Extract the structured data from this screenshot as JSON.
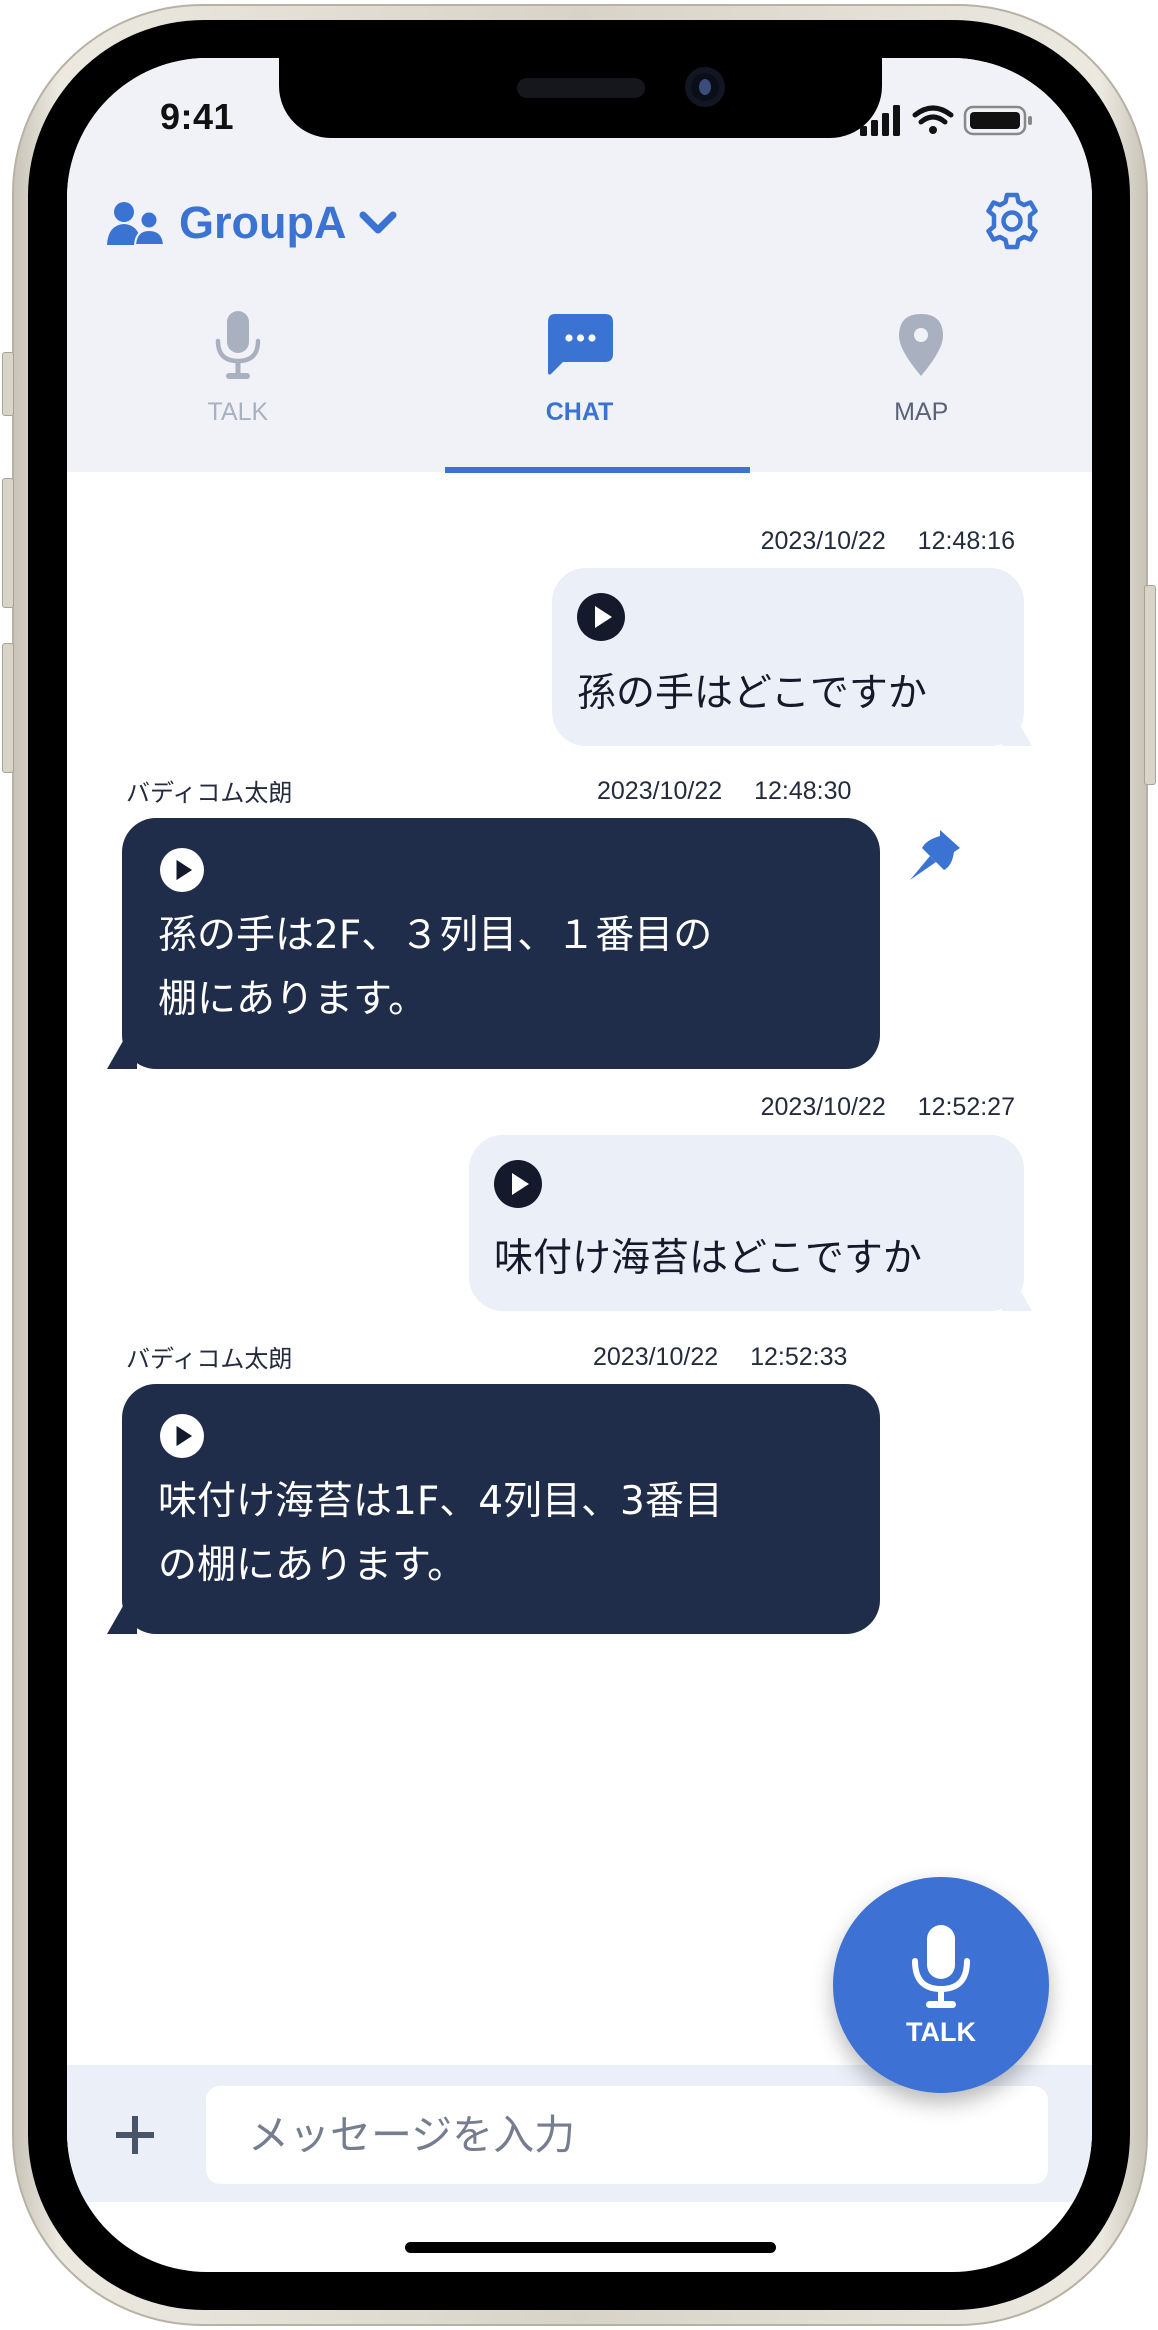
{
  "status_bar": {
    "time": "9:41",
    "icons": [
      "signal-icon",
      "wifi-icon",
      "battery-icon"
    ]
  },
  "header": {
    "group_icon": "group-users-icon",
    "group_name": "GroupA",
    "dropdown_icon": "chevron-down-icon",
    "settings_icon": "gear-icon"
  },
  "tabs": [
    {
      "label": "TALK",
      "icon": "microphone-icon",
      "active": false
    },
    {
      "label": "CHAT",
      "icon": "chat-bubble-icon",
      "active": true
    },
    {
      "label": "MAP",
      "icon": "map-pin-icon",
      "active": false
    }
  ],
  "messages": [
    {
      "direction": "outgoing",
      "sender": "",
      "timestamp": "2023/10/22　 12:48:16",
      "text": "孫の手はどこですか",
      "pinned": false
    },
    {
      "direction": "incoming",
      "sender": "バディコム太朗",
      "timestamp": "2023/10/22　 12:48:30",
      "text": "孫の手は2F、３列目、１番目の\n棚にあります。",
      "pinned": true
    },
    {
      "direction": "outgoing",
      "sender": "",
      "timestamp": "2023/10/22　 12:52:27",
      "text": "味付け海苔はどこですか",
      "pinned": false
    },
    {
      "direction": "incoming",
      "sender": "バディコム太朗",
      "timestamp": "2023/10/22　 12:52:33",
      "text": "味付け海苔は1F、4列目、3番目\nの棚にあります。",
      "pinned": false
    }
  ],
  "composer": {
    "add_icon": "plus-icon",
    "placeholder": "メッセージを入力",
    "value": ""
  },
  "fab": {
    "label": "TALK",
    "icon": "microphone-icon"
  },
  "colors": {
    "accent": "#3b73d3",
    "header_bg": "#f0f2f7",
    "outgoing_bubble": "#eaeff8",
    "incoming_bubble": "#1f2d4a",
    "inactive_tab": "#a9b1c1"
  }
}
